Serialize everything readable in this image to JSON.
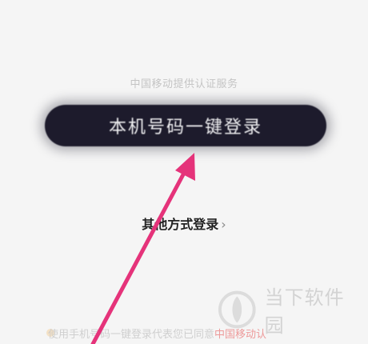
{
  "provider_notice": "中国移动提供认证服务",
  "one_click_login_label": "本机号码一键登录",
  "other_login": {
    "label": "其他方式登录",
    "chevron": "›"
  },
  "agreement": {
    "text": "使用手机号码一键登录代表您已同意",
    "link": "中国移动认"
  },
  "watermark_text": "当下软件园",
  "colors": {
    "background": "#f5f5f5",
    "button": "#1d1b2c",
    "arrow": "#e5337a",
    "agreement_link": "#ec8a8a"
  },
  "icons": [
    "arrow-annotation",
    "watermark-logo-icon",
    "chevron-right-icon"
  ]
}
